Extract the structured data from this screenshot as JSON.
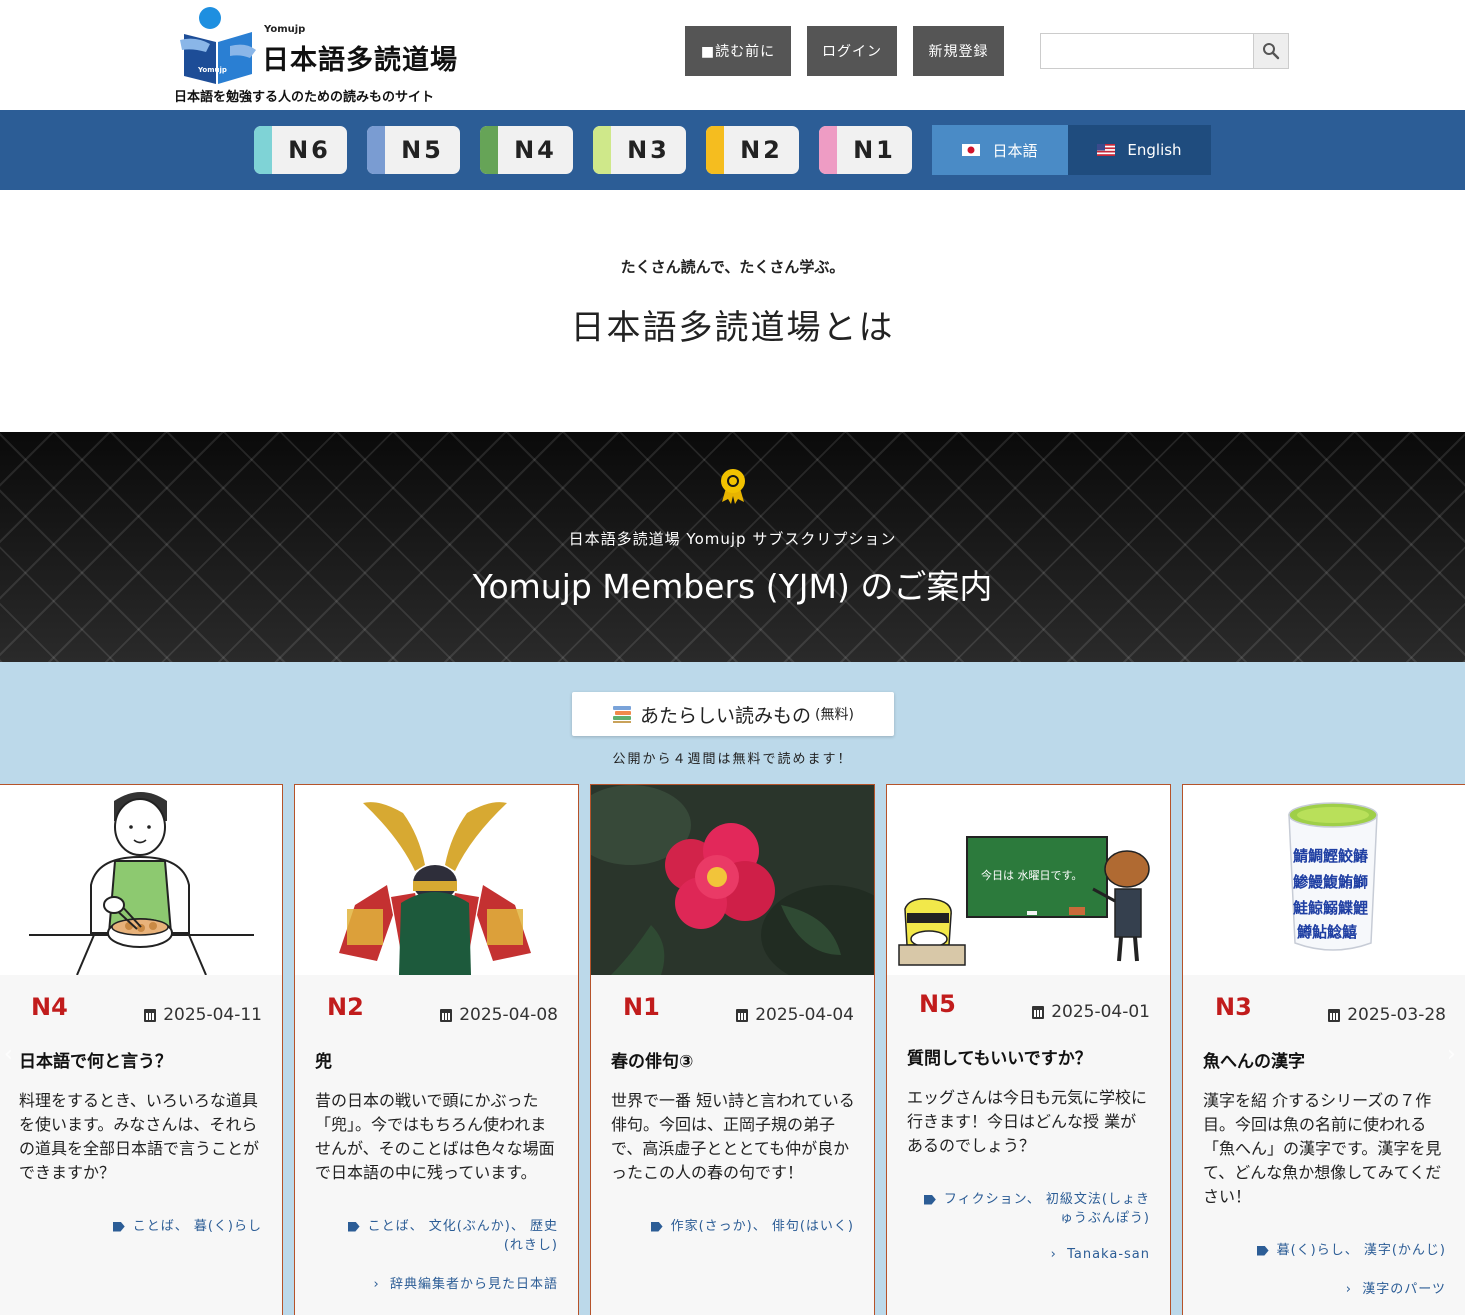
{
  "header": {
    "logo_small": "Yomujp",
    "logo_title": "日本語多読道場",
    "tagline": "日本語を勉強する人のための読みものサイト",
    "buttons": {
      "read_first": "■読む前に",
      "login": "ログイン",
      "register": "新規登録"
    },
    "search": {
      "placeholder": "",
      "icon": "search-icon"
    }
  },
  "levels": [
    "N6",
    "N5",
    "N4",
    "N3",
    "N2",
    "N1"
  ],
  "level_colors": [
    "#7fd3d6",
    "#7a9cd2",
    "#66a457",
    "#cfe88a",
    "#f5bd1f",
    "#ee9cc4"
  ],
  "languages": {
    "japanese": "日本語",
    "english": "English"
  },
  "intro": {
    "subtitle": "たくさん読んで、たくさん学ぶ。",
    "title": "日本語多読道場とは"
  },
  "members": {
    "subtitle": "日本語多読道場 Yomujp サブスクリプション",
    "title": "Yomujp Members (YJM) のご案内"
  },
  "news": {
    "pill_label": "あたらしい読みもの",
    "pill_small": "(無料)",
    "note": "公開から４週間は無料で読めます！"
  },
  "cards": [
    {
      "level": "N4",
      "date": "2025-04-11",
      "title": "日本語で何と言う？",
      "text": "料理をするとき、いろいろな道具を使います。みなさんは、それらの道具を全部日本語で言うことができますか？",
      "tags": "ことば、 暮(く)らし",
      "series": ""
    },
    {
      "level": "N2",
      "date": "2025-04-08",
      "title": "兜",
      "text": "昔の日本の戦いで頭にかぶった「兜」。今ではもちろん使われませんが、そのことばは色々な場面で日本語の中に残っています。",
      "tags": "ことば、 文化(ぶんか)、 歴史(れきし)",
      "series": "辞典編集者から見た日本語"
    },
    {
      "level": "N1",
      "date": "2025-04-04",
      "title": "春の俳句③",
      "text": "世界で一番 短い詩と言われている俳句。今回は、正岡子規の弟子で、高浜虚子とととても仲が良かったこの人の春の句です！",
      "tags": "作家(さっか)、 俳句(はいく)",
      "series": ""
    },
    {
      "level": "N5",
      "date": "2025-04-01",
      "title": "質問してもいいですか？",
      "text": "エッグさんは今日も元気に学校に行きます！今日はどんな授 業があるのでしょう？",
      "tags": "フィクション、 初級文法(しょきゅうぶんぽう)",
      "series": "Tanaka-san",
      "board_text": "今日は 水曜日です。"
    },
    {
      "level": "N3",
      "date": "2025-03-28",
      "title": "魚へんの漢字",
      "text": "漢字を紹 介するシリーズの７作目。今回は魚の名前に使われる「魚へん」の漢字です。漢字を見て、どんな魚か想像してみてください！",
      "tags": "暮(く)らし、 漢字(かんじ)",
      "series": "漢字のパーツ",
      "cup_kanji": "鯖鯛鰹鮫鰆鯵鰻鰒鮪鰤鮭鯨鰯鰈鯉鱒鮎鯰鱚鰺"
    }
  ]
}
